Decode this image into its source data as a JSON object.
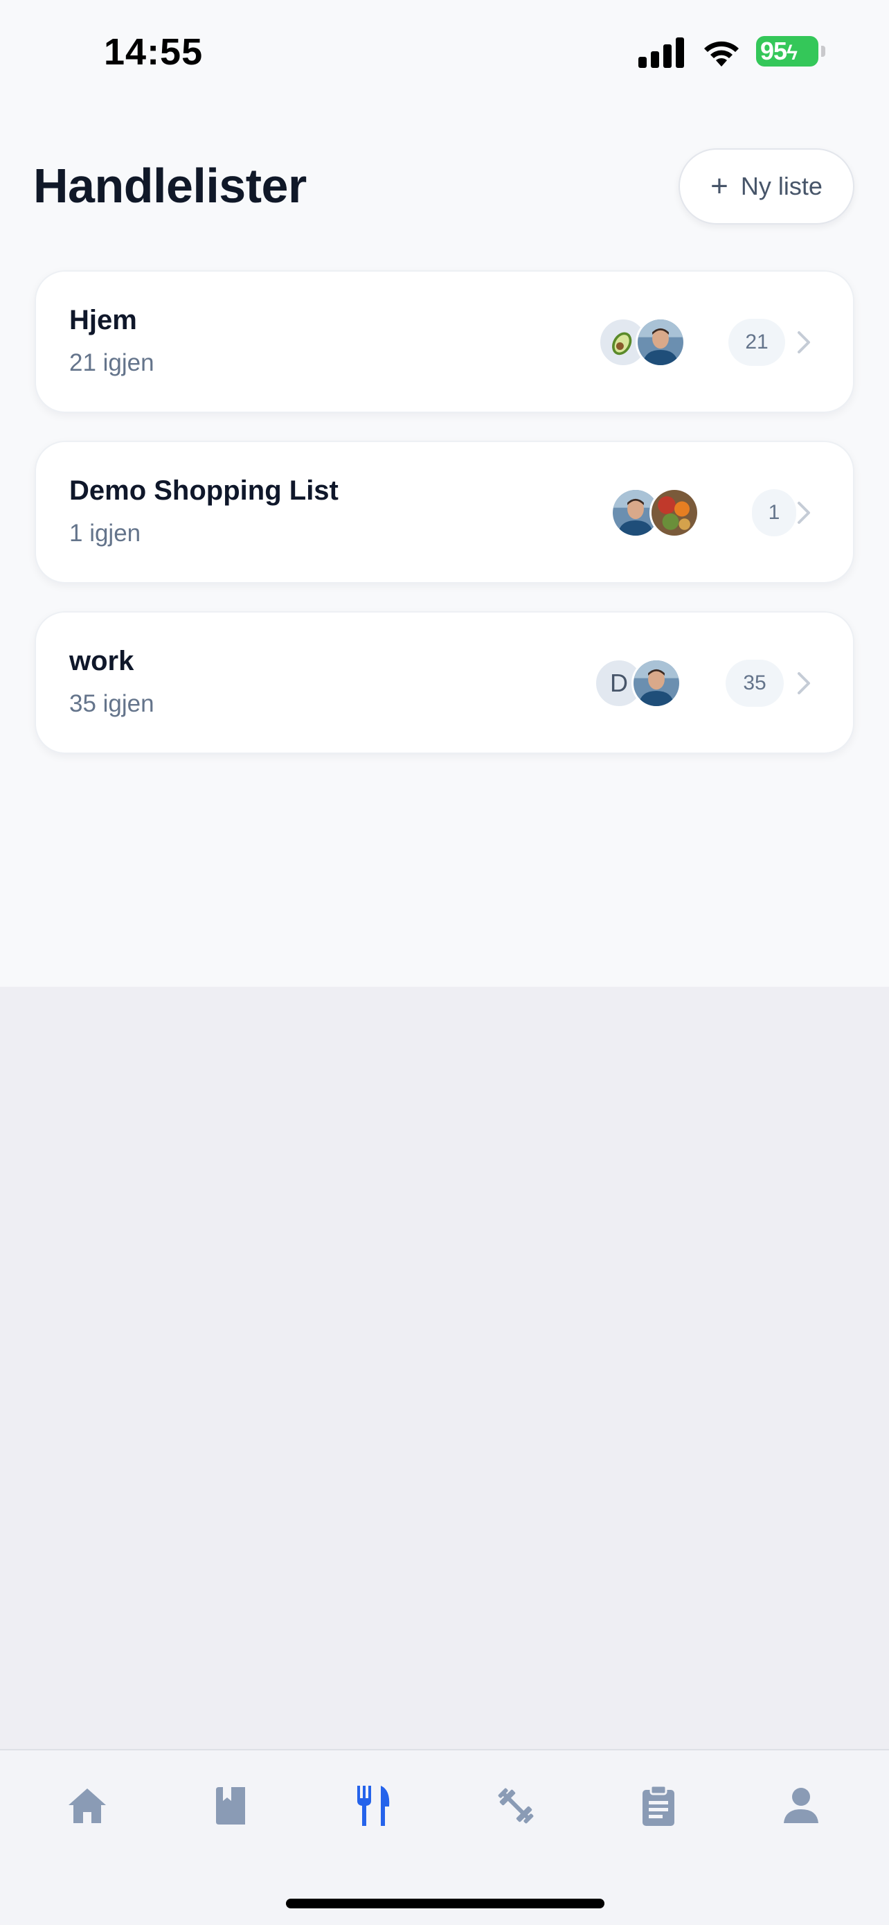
{
  "status_bar": {
    "time": "14:55",
    "battery": "95",
    "icons": [
      "signal-icon",
      "wifi-icon",
      "battery-charging-icon"
    ]
  },
  "header": {
    "title": "Handlelister",
    "new_list_label": "Ny liste",
    "new_list_icon": "plus-icon"
  },
  "lists": [
    {
      "name": "Hjem",
      "remaining": "21 igjen",
      "count": "21",
      "avatars": [
        "avocado-emoji-avatar",
        "user-photo-avatar"
      ]
    },
    {
      "name": "Demo Shopping List",
      "remaining": "1 igjen",
      "count": "1",
      "avatars": [
        "user-photo-avatar",
        "food-photo-avatar"
      ]
    },
    {
      "name": "work",
      "remaining": "35 igjen",
      "count": "35",
      "avatars": [
        "letter-avatar",
        "user-photo-avatar"
      ],
      "letter": "D"
    }
  ],
  "tabbar": {
    "tabs": [
      "home-icon",
      "book-icon",
      "fork-knife-icon",
      "dumbbell-icon",
      "clipboard-icon",
      "person-icon"
    ],
    "active": "fork-knife-icon"
  },
  "colors": {
    "accent": "#2563eb",
    "inactive_icon": "#8a9bb5",
    "battery": "#34c759",
    "title": "#101828",
    "subtitle": "#64748b"
  }
}
